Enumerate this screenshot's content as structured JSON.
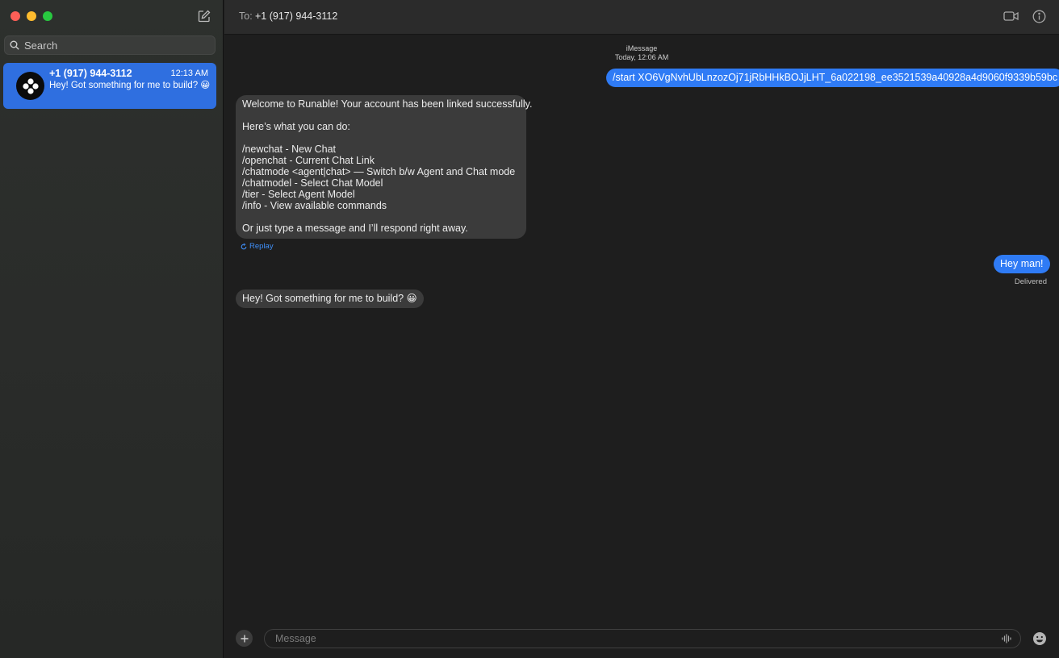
{
  "sidebar": {
    "search_placeholder": "Search",
    "conversations": [
      {
        "name": "+1 (917) 944-3112",
        "time": "12:13 AM",
        "preview": "Hey! Got something for me to build? 😀"
      }
    ]
  },
  "header": {
    "to_label": "To:",
    "recipient": "+1 (917) 944-3112"
  },
  "thread": {
    "service": "iMessage",
    "timestamp": "Today, 12:06 AM",
    "messages": [
      {
        "direction": "out",
        "text": "/start XO6VgNvhUbLnzozOj71jRbHHkBOJjLHT_6a022198_ee3521539a40928a4d9060f9339b59bc"
      },
      {
        "direction": "in",
        "lines": [
          "Welcome to Runable! Your account has been linked successfully.",
          "",
          "Here’s what you can do:",
          "",
          "/newchat - New Chat",
          "/openchat - Current Chat Link",
          "/chatmode <agent|chat> — Switch b/w Agent and Chat mode",
          "/chatmodel - Select Chat Model",
          "/tier - Select Agent Model",
          "/info - View available commands",
          "",
          "Or just type a message and I’ll respond right away."
        ],
        "action": "Replay"
      },
      {
        "direction": "out",
        "text": "Hey man!",
        "status": "Delivered"
      },
      {
        "direction": "in",
        "text": "Hey! Got something for me to build? 😀"
      }
    ]
  },
  "composer": {
    "placeholder": "Message"
  },
  "colors": {
    "outgoing_bubble": "#2f7bf5",
    "incoming_bubble": "#3b3b3b",
    "selected_conversation": "#2f6fe0"
  }
}
